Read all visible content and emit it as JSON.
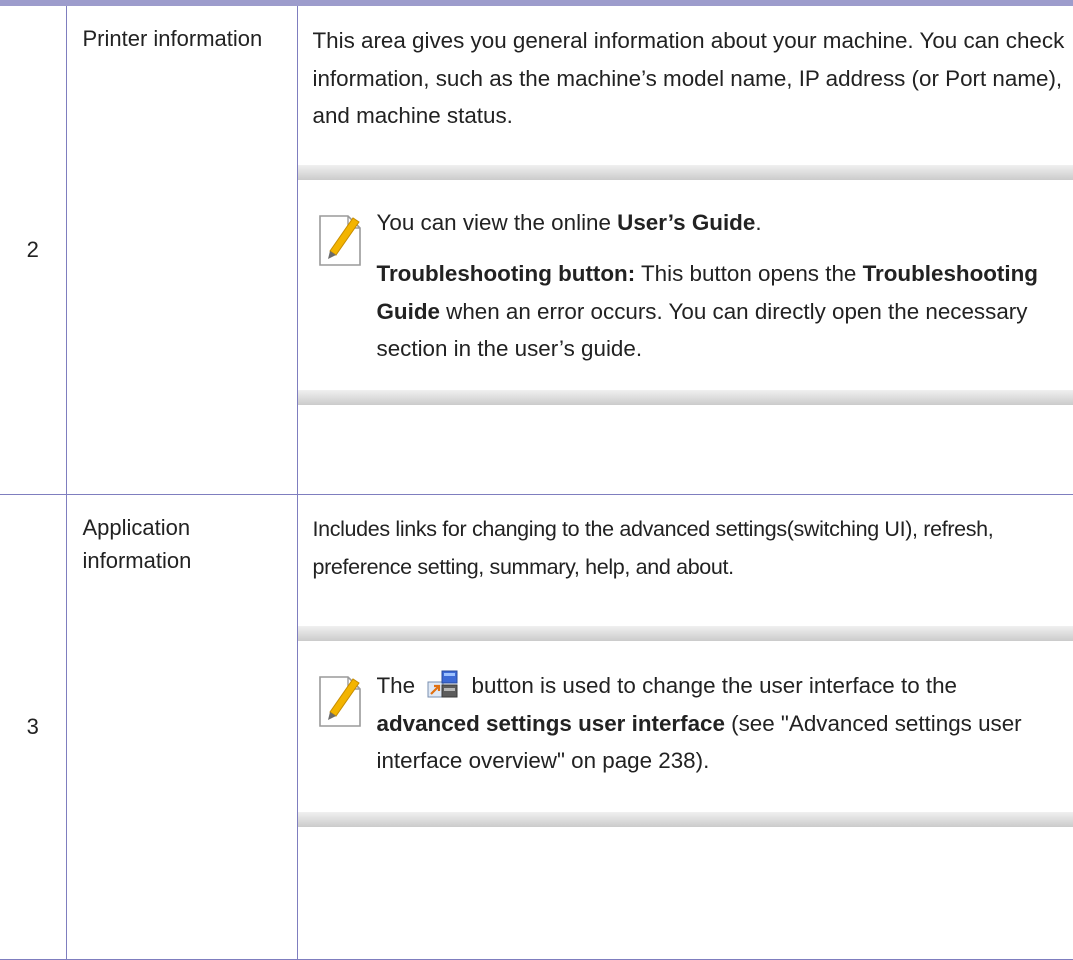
{
  "rows": [
    {
      "num": "2",
      "name": "Printer information",
      "description": "This area gives you general information about your machine. You can check information, such as the machine’s model name, IP address (or Port name), and machine status.",
      "note": {
        "icon": "note-pencil-icon",
        "line1_prefix": "You can view the online ",
        "line1_bold": "User’s Guide",
        "line1_suffix": ".",
        "line2_bold1": " Troubleshooting button:",
        "line2_text1": " This button opens the ",
        "line2_bold2": "Troubleshooting Guide",
        "line2_text2": " when an error occurs. You can directly open the necessary section in the user’s guide."
      }
    },
    {
      "num": "3",
      "name": "Application information",
      "description": "Includes links for changing to the advanced settings(switching UI), refresh, preference setting, summary, help, and about.",
      "note": {
        "icon": "note-pencil-icon",
        "line1_prefix": "The ",
        "inline_icon": "switch-ui-icon",
        "line1_text": " button is used to change the user interface to the ",
        "line1_bold": "advanced settings user interface",
        "line1_suffix": " (see \"Advanced settings user interface overview\" on page 238)."
      }
    }
  ],
  "colors": {
    "top_rule": "#9d9ccc",
    "table_border": "#7f7ebf",
    "note_rule": "#cbcbcb"
  }
}
